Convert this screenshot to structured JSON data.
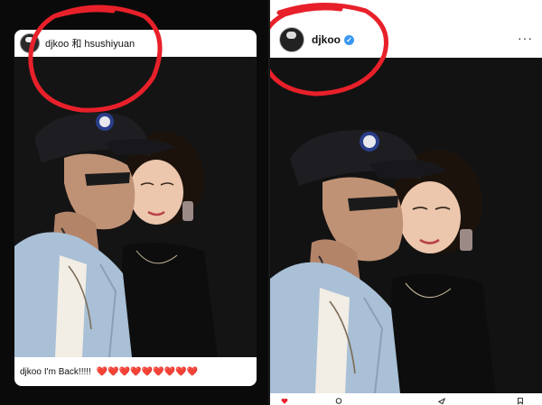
{
  "story": {
    "usernames": "djkoo 和 hsushiyuan",
    "caption_user": "djkoo",
    "caption_text": "I'm Back!!!!!",
    "hearts": "❤️❤️❤️❤️❤️❤️❤️❤️❤️"
  },
  "post": {
    "username": "djkoo",
    "verified_icon": "verified-badge-icon",
    "more_icon": "more-options-icon",
    "more_glyph": "···"
  },
  "colors": {
    "annotation": "#e8202a",
    "verified": "#3897f0",
    "heart": "#e0222e"
  }
}
